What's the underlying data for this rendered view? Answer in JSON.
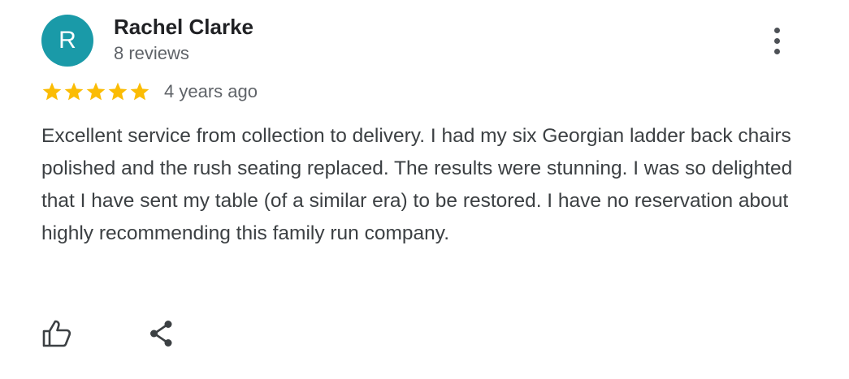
{
  "reviewer": {
    "initial": "R",
    "avatar_color": "#1a9aa8",
    "name": "Rachel Clarke",
    "reviews": "8 reviews"
  },
  "review": {
    "rating": 5,
    "max_rating": 5,
    "star_color": "#fbbc04",
    "time_ago": "4 years ago",
    "text": "Excellent service from collection to delivery. I had my six Georgian ladder back chairs polished and the rush seating replaced. The results were stunning. I was so delighted that I have sent my table (of a similar era) to be restored. I have no reservation about highly recommending this family run company."
  },
  "icons": {
    "more": "more-vertical-icon",
    "like": "thumbs-up-icon",
    "share": "share-icon"
  }
}
